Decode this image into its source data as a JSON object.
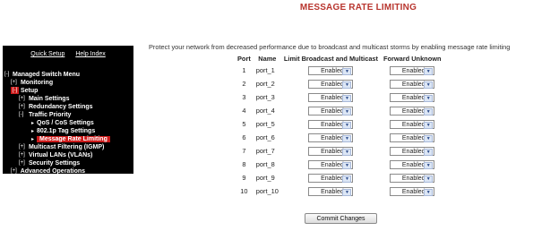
{
  "page": {
    "title": "MESSAGE RATE LIMITING"
  },
  "sidebar": {
    "links": {
      "quick_setup": "Quick Setup",
      "help_index": "Help Index"
    },
    "items": [
      {
        "label": "Managed Switch Menu",
        "toggle": "[-]"
      },
      {
        "label": "Monitoring",
        "toggle": "[+]"
      },
      {
        "label": "Setup",
        "toggle": "[-]"
      },
      {
        "label": "Main Settings",
        "toggle": "[+]"
      },
      {
        "label": "Redundancy Settings",
        "toggle": "[+]"
      },
      {
        "label": "Traffic Priority",
        "toggle": "[-]"
      },
      {
        "label": "QoS / CoS Settings",
        "toggle": "▸"
      },
      {
        "label": "802.1p Tag Settings",
        "toggle": "▸"
      },
      {
        "label": "Message Rate Limiting",
        "toggle": "▸",
        "selected": true
      },
      {
        "label": "Multicast Filtering (IGMP)",
        "toggle": "[+]"
      },
      {
        "label": "Virtual LANs (VLANs)",
        "toggle": "[+]"
      },
      {
        "label": "Security Settings",
        "toggle": "[+]"
      },
      {
        "label": "Advanced Operations",
        "toggle": "[+]"
      }
    ]
  },
  "main": {
    "description": "Protect your network from decreased performance due to broadcast and multicast storms by enabling message rate limiting",
    "table": {
      "headers": [
        "Port",
        "Name",
        "Limit Broadcast and Multicast",
        "Forward Unknown"
      ],
      "rows": [
        {
          "port": "1",
          "name": "port_1",
          "limit": "Enabled",
          "forward": "Enabled"
        },
        {
          "port": "2",
          "name": "port_2",
          "limit": "Enabled",
          "forward": "Enabled"
        },
        {
          "port": "3",
          "name": "port_3",
          "limit": "Enabled",
          "forward": "Enabled"
        },
        {
          "port": "4",
          "name": "port_4",
          "limit": "Enabled",
          "forward": "Enabled"
        },
        {
          "port": "5",
          "name": "port_5",
          "limit": "Enabled",
          "forward": "Enabled"
        },
        {
          "port": "6",
          "name": "port_6",
          "limit": "Enabled",
          "forward": "Enabled"
        },
        {
          "port": "7",
          "name": "port_7",
          "limit": "Enabled",
          "forward": "Enabled"
        },
        {
          "port": "8",
          "name": "port_8",
          "limit": "Enabled",
          "forward": "Enabled"
        },
        {
          "port": "9",
          "name": "port_9",
          "limit": "Enabled",
          "forward": "Enabled"
        },
        {
          "port": "10",
          "name": "port_10",
          "limit": "Enabled",
          "forward": "Enabled"
        }
      ]
    },
    "commit_label": "Commit Changes"
  },
  "colors": {
    "title": "#b8352e",
    "sidebar_bg": "#000000",
    "selected_bg": "#cc1b1b"
  },
  "icons": {
    "dropdown": "chevron-down-icon",
    "collapse": "minus-box-icon",
    "expand": "plus-box-icon",
    "leaf": "arrow-bullet-icon"
  }
}
